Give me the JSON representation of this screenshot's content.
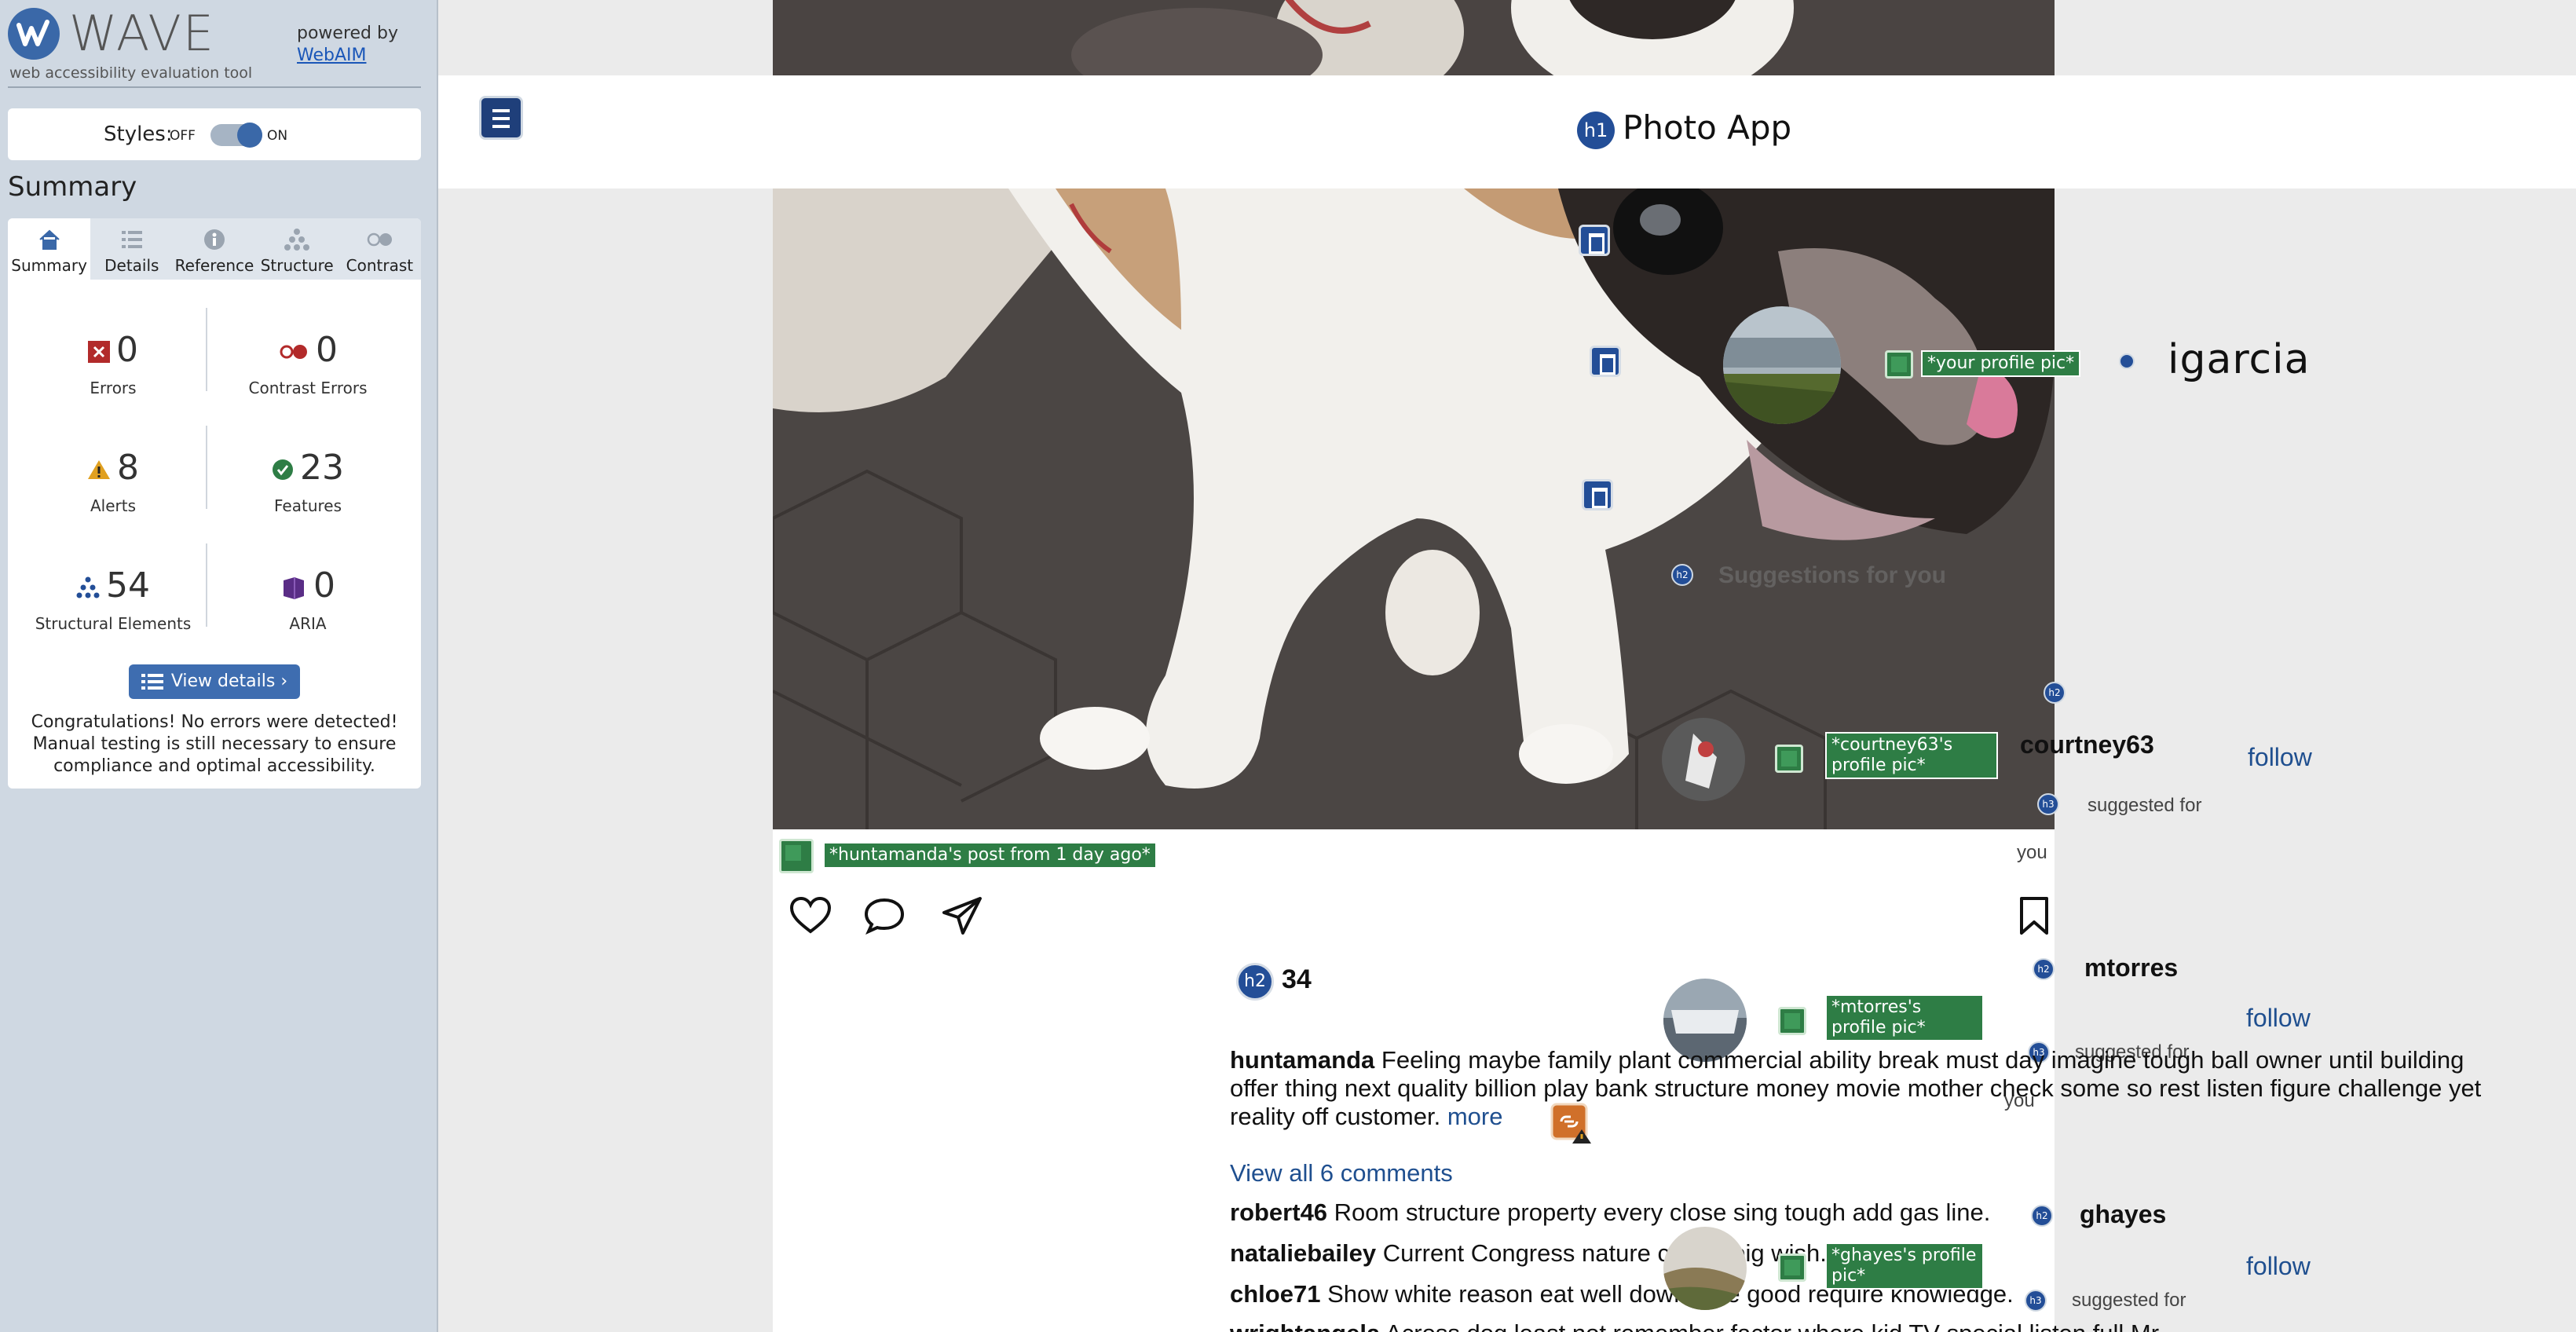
{
  "wave": {
    "title": "WAVE",
    "tagline": "web accessibility evaluation tool",
    "powered_by": "powered by",
    "webaim_link": "WebAIM",
    "styles_label": "Styles:",
    "styles_off": "OFF",
    "styles_on": "ON",
    "summary_heading": "Summary",
    "tabs": [
      {
        "label": "Summary",
        "icon": "home-icon"
      },
      {
        "label": "Details",
        "icon": "list-icon"
      },
      {
        "label": "Reference",
        "icon": "info-icon"
      },
      {
        "label": "Structure",
        "icon": "hierarchy-icon"
      },
      {
        "label": "Contrast",
        "icon": "contrast-icon"
      }
    ],
    "stats": {
      "errors": {
        "value": "0",
        "label": "Errors",
        "color": "#b22a2a"
      },
      "contrast_errors": {
        "value": "0",
        "label": "Contrast Errors",
        "color": "#b22a2a"
      },
      "alerts": {
        "value": "8",
        "label": "Alerts",
        "color": "#e0a020"
      },
      "features": {
        "value": "23",
        "label": "Features",
        "color": "#2e7d45"
      },
      "structural": {
        "value": "54",
        "label": "Structural Elements",
        "color": "#234e97"
      },
      "aria": {
        "value": "0",
        "label": "ARIA",
        "color": "#5a2d86"
      }
    },
    "view_details": "View details ›",
    "congrats": "Congratulations! No errors were detected! Manual testing is still necessary to ensure compliance and optimal accessibility."
  },
  "app": {
    "h1_badge": "h1",
    "title": "Photo App",
    "username": "igarcia",
    "your_profile_alt": "*your profile pic*",
    "suggestions_title": "Suggestions for you",
    "suggestions": [
      {
        "name": "courtney63",
        "alt": "*courtney63's profile pic*",
        "sub": "suggested for",
        "you": "you",
        "follow": "follow"
      },
      {
        "name": "mtorres",
        "alt": "*mtorres's profile pic*",
        "sub": "suggested for",
        "you": "you",
        "follow": "follow"
      },
      {
        "name": "ghayes",
        "alt": "*ghayes's profile pic*",
        "sub": "suggested for",
        "follow": "follow"
      }
    ],
    "post": {
      "alt": "*huntamanda's post from 1 day ago*",
      "h2_badge": "h2",
      "likes": "34",
      "author": "huntamanda",
      "caption": "Feeling maybe family plant commercial ability break must day imagine tough ball owner until building offer thing next quality billion play bank structure money movie mother check some so rest listen figure challenge yet reality off customer.",
      "more": "more",
      "view_all": "View all 6 comments",
      "comments": [
        {
          "user": "robert46",
          "text": "Room structure property every close sing tough add gas line."
        },
        {
          "user": "nataliebailey",
          "text": "Current Congress nature create big wish."
        },
        {
          "user": "chloe71",
          "text": "Show white reason eat well down type good require knowledge."
        },
        {
          "user": "wrightangela",
          "text": "Across dog least not remember factor where kid TV special listen full Mr."
        }
      ]
    },
    "badges": {
      "h2": "h2",
      "h3": "h3"
    }
  }
}
